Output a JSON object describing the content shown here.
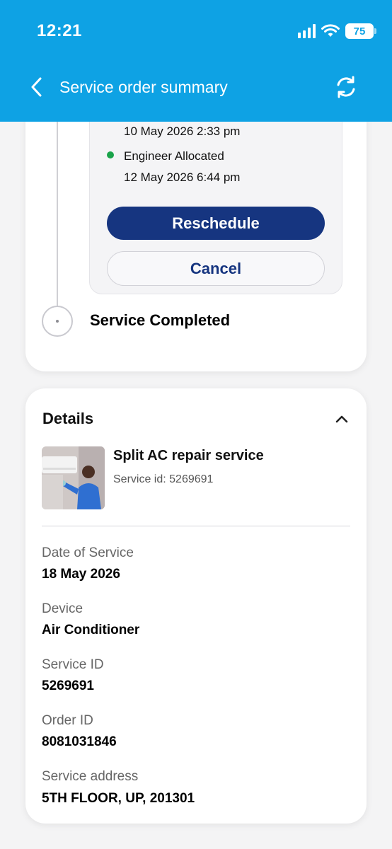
{
  "status_bar": {
    "time": "12:21",
    "battery": "75"
  },
  "header": {
    "title": "Service order summary"
  },
  "timeline": {
    "prev_event_date": "10 May 2026 2:33 pm",
    "event_label": "Engineer Allocated",
    "event_date": "12 May 2026 6:44 pm",
    "reschedule_label": "Reschedule",
    "cancel_label": "Cancel",
    "final_step_label": "Service Completed",
    "event_dot_color": "#1aa34a"
  },
  "details": {
    "title": "Details",
    "service_name": "Split AC repair service",
    "service_id_line": "Service id: 5269691",
    "fields": [
      {
        "label": "Date of Service",
        "value": "18 May 2026"
      },
      {
        "label": "Device",
        "value": "Air Conditioner"
      },
      {
        "label": "Service ID",
        "value": "5269691"
      },
      {
        "label": "Order ID",
        "value": "8081031846"
      },
      {
        "label": "Service address",
        "value": "5TH FLOOR, UP, 201301"
      }
    ]
  },
  "colors": {
    "header": "#0ea2e4",
    "primary_button": "#163580"
  },
  "icons": [
    "back-arrow-icon",
    "refresh-icon",
    "chevron-up-icon",
    "signal-icon",
    "wifi-icon",
    "battery-icon"
  ]
}
